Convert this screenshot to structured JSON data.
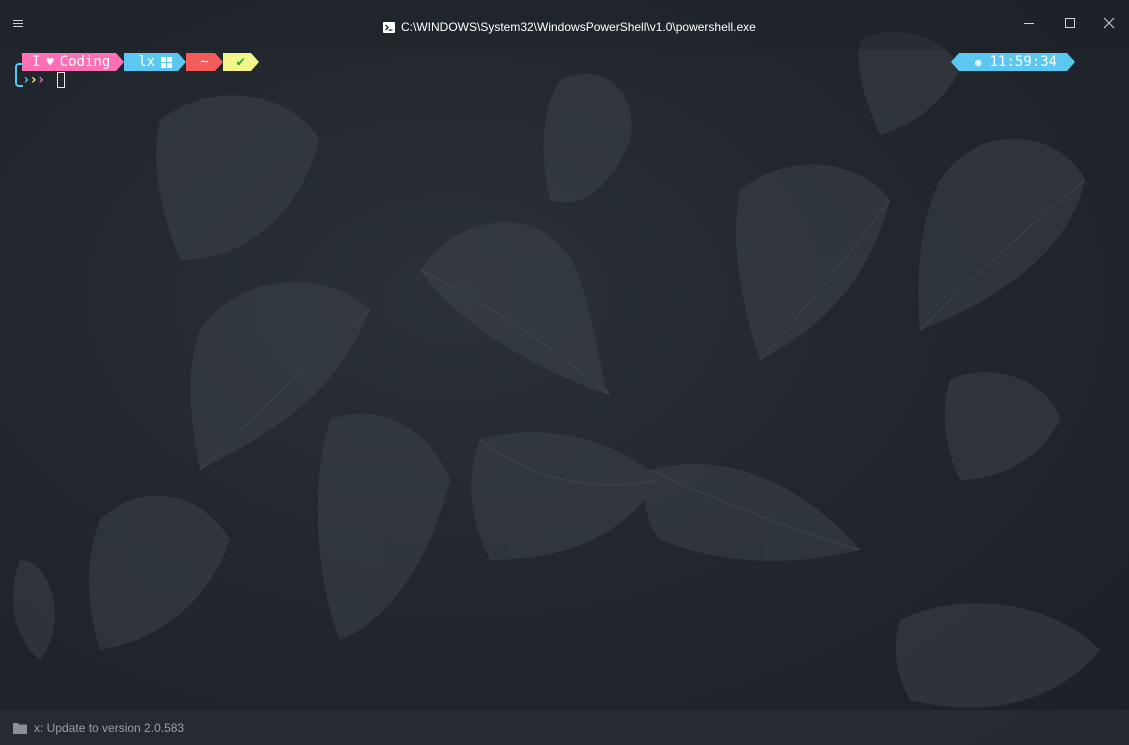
{
  "window": {
    "title": "C:\\WINDOWS\\System32\\WindowsPowerShell\\v1.0\\powershell.exe",
    "icons": {
      "menu": "hamburger-menu-icon",
      "app": "powershell-icon",
      "minimize": "minimize-icon",
      "maximize": "maximize-icon",
      "close": "close-icon"
    }
  },
  "prompt": {
    "segment_coding_left": "I",
    "segment_coding_heart": "♥",
    "segment_coding_right": "Coding",
    "segment_user": "lx",
    "segment_path": "~",
    "segment_status": "✔",
    "chevrons": [
      "›",
      "›",
      "›"
    ],
    "colors": {
      "coding": "#ff6fb5",
      "user": "#5cc8f2",
      "path": "#f45b5b",
      "status": "#f2f58a"
    }
  },
  "clock": {
    "time": "11:59:34",
    "icon": "clock-icon"
  },
  "statusbar": {
    "text": "x: Update to version 2.0.583",
    "icon": "folder-icon"
  }
}
